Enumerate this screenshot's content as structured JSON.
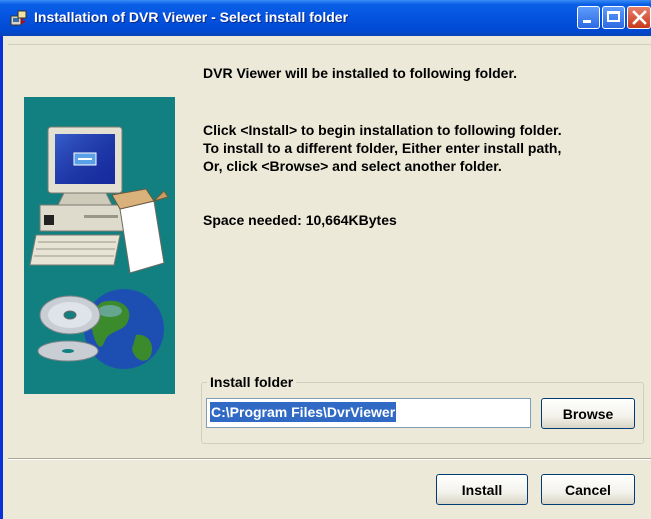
{
  "window": {
    "title": "Installation of DVR Viewer - Select install folder",
    "titlebar_color": "#0554e0",
    "close_button_color": "#c8381a"
  },
  "illustration": {
    "background_color": "#128080",
    "icons": [
      "computer-icon",
      "software-box-icon",
      "cd-disc-icon",
      "globe-icon"
    ]
  },
  "message": {
    "line1": "DVR Viewer will be installed to following folder.",
    "line2": "Click <Install> to begin installation to following folder.",
    "line3": "To install to a different folder, Either enter install path,",
    "line4": "Or, click <Browse> and select another folder.",
    "space_needed": "Space needed: 10,664KBytes"
  },
  "install_folder": {
    "label": "Install folder",
    "path_value": "C:\\Program Files\\DvrViewer",
    "browse_label": "Browse"
  },
  "buttons": {
    "install_label": "Install",
    "cancel_label": "Cancel"
  }
}
